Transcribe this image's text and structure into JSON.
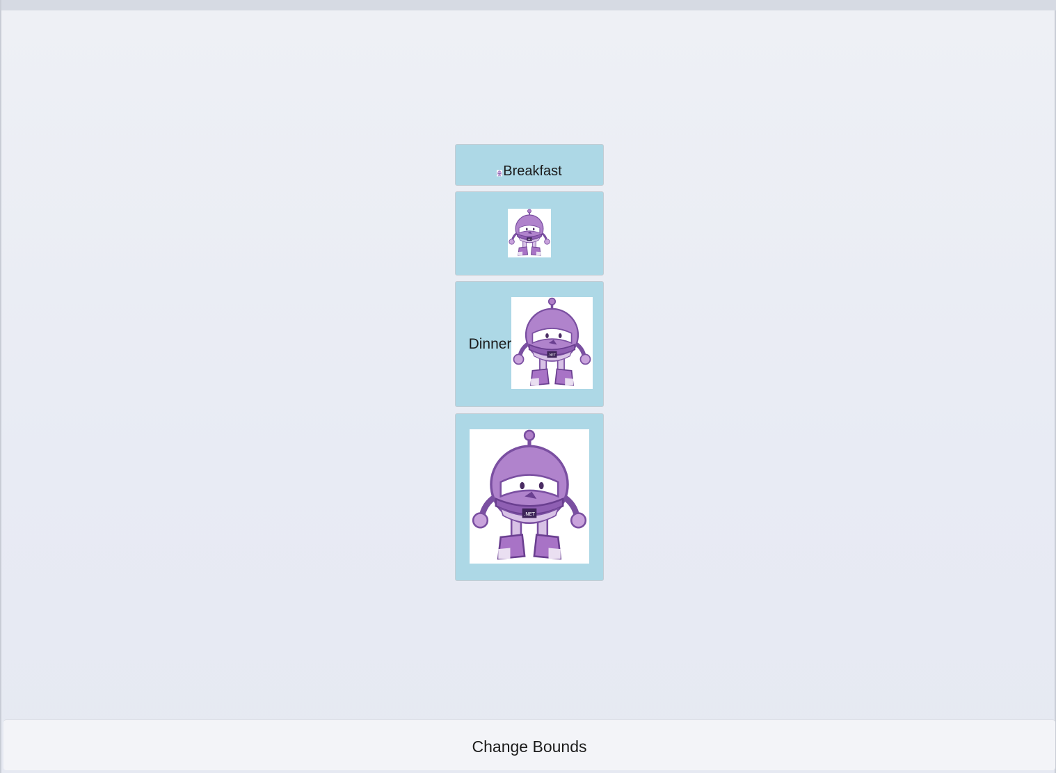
{
  "window": {
    "titlebar_color": "#d6dae3",
    "background_color": "#e9ebf3"
  },
  "cards": [
    {
      "label": "Breakfast",
      "icon": "robot-icon",
      "background": "#add8e6"
    },
    {
      "label": "",
      "icon": "robot-icon",
      "background": "#add8e6"
    },
    {
      "label": "Dinner",
      "icon": "robot-icon",
      "background": "#add8e6"
    },
    {
      "label": "",
      "icon": "robot-icon",
      "background": "#add8e6"
    }
  ],
  "footer": {
    "button_label": "Change Bounds"
  }
}
